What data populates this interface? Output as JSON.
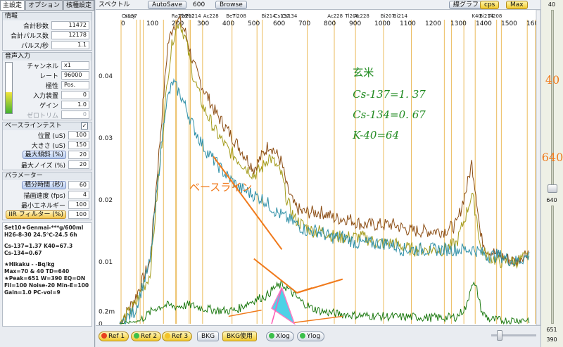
{
  "tabs": [
    "主設定",
    "オプション",
    "核種設定"
  ],
  "counts": {
    "header": "情報",
    "rows": [
      {
        "label": "合計秒数",
        "value": "11472"
      },
      {
        "label": "合計パルス数",
        "value": "12178"
      },
      {
        "label": "パルス/秒",
        "value": "1.1"
      }
    ]
  },
  "audio": {
    "header": "音声入力",
    "rows": [
      {
        "label": "チャンネル",
        "value": "x1"
      },
      {
        "label": "レート",
        "value": "96000"
      },
      {
        "label": "極性",
        "value": "Pos."
      },
      {
        "label": "入力装置",
        "value": "0"
      },
      {
        "label": "ゲイン",
        "value": "1.0"
      },
      {
        "label": "ゼロトリム",
        "value": "0"
      }
    ]
  },
  "baseline": {
    "header": "ベースラインテスト",
    "checked": "✓",
    "rows": [
      {
        "label": "位置 (uS)",
        "value": "100"
      },
      {
        "label": "大きさ (uS)",
        "value": "150"
      },
      {
        "label": "最大傾斜 (%)",
        "value": "20"
      },
      {
        "label": "最大ノイズ (%)",
        "value": "20"
      }
    ]
  },
  "params": {
    "header": "パラメーター",
    "rows": [
      {
        "label": "積分時間 (秒)",
        "value": "60"
      },
      {
        "label": "描画速度 (fps)",
        "value": "4"
      },
      {
        "label": "最小エネルギー",
        "value": "100"
      },
      {
        "label": "IIR フィルター (%)",
        "value": "100"
      }
    ]
  },
  "info": [
    "Set10★Genmai-***g/600ml",
    "H26-8-30  24.5℃-24.5  6h",
    "",
    "Cs-137=1.37  K40=67.3",
    "Cs-134=0.67",
    "",
    "★Hikaku    - -Bq/kg",
    "Max=70 & 40 TD=640",
    "★Peak=651 W=390 EQ=ON",
    "Fil=100  Noise-20  Min-E=100",
    "Gain=1.0 PC-vol=9"
  ],
  "toolbar": {
    "title": "スペクトル",
    "autosave": "AutoSave",
    "channel_value": "600",
    "browse": "Browse",
    "line_graph": "線グラフ",
    "cps": "cps",
    "max": "Max"
  },
  "right": {
    "top": "40",
    "big1": "40",
    "big2": "640",
    "mid": "640",
    "bot1": "651",
    "bot2": "390"
  },
  "bottom": {
    "ref1": "Ref 1",
    "ref2": "Ref 2",
    "ref3": "Ref 3",
    "bkg": "BKG",
    "bkg_use": "BKG使用",
    "xlog": "Xlog",
    "ylog": "Ylog"
  },
  "annotation": {
    "sample": "玄米",
    "lines": [
      "Cs-137=1. 37",
      "Cs-134=0. 67",
      "K-40=64"
    ],
    "baseline_label": "ベースライン"
  },
  "chart_data": {
    "type": "line",
    "x_ticks": [
      0,
      100,
      200,
      300,
      400,
      500,
      600,
      700,
      800,
      900,
      1000,
      1100,
      1200,
      1300,
      1400,
      1500,
      1600
    ],
    "y_ticks": [
      "0.04",
      "0.03",
      "0.02",
      "0.01",
      "0.2m",
      "0"
    ],
    "nuclide_labels": [
      "Cs137",
      "Xray",
      "Ra226",
      "Pb212",
      "Pb214",
      "Ac228",
      "Be7",
      "Tl208",
      "Bi214",
      "Cs137",
      "Cs134",
      "Ac228",
      "Tl208",
      "Ac228",
      "Bi207",
      "Bi214",
      "K40",
      "Bi214",
      "Tl208"
    ],
    "colors": {
      "brown": "#8b4c12",
      "olive": "#a29a18",
      "teal": "#2e8fa6",
      "green": "#1d7a12",
      "marker": "#e8b040",
      "accent": "#f07a1c"
    },
    "series": [
      {
        "color": "brown",
        "x": [
          0,
          60,
          120,
          190,
          210,
          235,
          260,
          290,
          330,
          380,
          430,
          480,
          530,
          560,
          590,
          610,
          640,
          660,
          690,
          720,
          760,
          800,
          850,
          900,
          960,
          1020,
          1080,
          1150,
          1220,
          1280,
          1330,
          1370,
          1390,
          1410,
          1425,
          1450,
          1500,
          1560,
          1620
        ],
        "y": [
          0.0,
          0.004,
          0.01,
          0.045,
          0.048,
          0.049,
          0.047,
          0.042,
          0.038,
          0.034,
          0.031,
          0.028,
          0.025,
          0.027,
          0.029,
          0.028,
          0.026,
          0.022,
          0.019,
          0.018,
          0.018,
          0.018,
          0.017,
          0.017,
          0.016,
          0.016,
          0.016,
          0.015,
          0.015,
          0.015,
          0.016,
          0.022,
          0.026,
          0.02,
          0.014,
          0.012,
          0.011,
          0.01,
          0.012
        ]
      },
      {
        "color": "olive",
        "x": [
          0,
          60,
          120,
          190,
          210,
          235,
          260,
          290,
          330,
          380,
          430,
          480,
          530,
          560,
          590,
          610,
          640,
          660,
          690,
          720,
          760,
          800,
          850,
          900,
          960,
          1020,
          1080,
          1150,
          1220,
          1280,
          1330,
          1370,
          1390,
          1410,
          1425,
          1450,
          1500,
          1560,
          1620
        ],
        "y": [
          0.0,
          0.003,
          0.008,
          0.04,
          0.046,
          0.049,
          0.046,
          0.04,
          0.035,
          0.031,
          0.028,
          0.026,
          0.024,
          0.025,
          0.027,
          0.026,
          0.024,
          0.02,
          0.017,
          0.016,
          0.015,
          0.015,
          0.014,
          0.014,
          0.014,
          0.013,
          0.013,
          0.012,
          0.012,
          0.012,
          0.013,
          0.018,
          0.021,
          0.017,
          0.012,
          0.011,
          0.01,
          0.01,
          0.011
        ]
      },
      {
        "color": "teal",
        "x": [
          0,
          60,
          120,
          180,
          210,
          240,
          270,
          300,
          340,
          380,
          420,
          470,
          520,
          570,
          620,
          660,
          700,
          740,
          780,
          830,
          880,
          940,
          1000,
          1060,
          1120,
          1180,
          1240,
          1300,
          1360,
          1400,
          1450,
          1500,
          1560,
          1620
        ],
        "y": [
          0.0,
          0.002,
          0.01,
          0.035,
          0.039,
          0.037,
          0.034,
          0.031,
          0.028,
          0.026,
          0.024,
          0.022,
          0.021,
          0.02,
          0.018,
          0.017,
          0.016,
          0.015,
          0.015,
          0.014,
          0.014,
          0.013,
          0.013,
          0.013,
          0.012,
          0.012,
          0.012,
          0.012,
          0.012,
          0.012,
          0.011,
          0.011,
          0.01,
          0.011
        ]
      },
      {
        "color": "green",
        "x": [
          0,
          80,
          140,
          180,
          220,
          280,
          330,
          380,
          420,
          460,
          500,
          540,
          580,
          610,
          640,
          660,
          690,
          720,
          760,
          800,
          860,
          920,
          980,
          1040,
          1100,
          1160,
          1220,
          1280,
          1330,
          1370,
          1390,
          1410,
          1430,
          1460,
          1520,
          1580,
          1620
        ],
        "y": [
          0.0,
          0.0005,
          0.0025,
          0.003,
          0.0028,
          0.003,
          0.0025,
          0.0022,
          0.0021,
          0.0022,
          0.0032,
          0.004,
          0.0045,
          0.0058,
          0.0063,
          0.0058,
          0.0046,
          0.0035,
          0.0025,
          0.002,
          0.0016,
          0.0014,
          0.0013,
          0.0012,
          0.0011,
          0.0011,
          0.001,
          0.001,
          0.0011,
          0.0028,
          0.0068,
          0.0055,
          0.0018,
          0.0007,
          0.0005,
          0.0006,
          0.0007
        ]
      }
    ],
    "xlim": [
      0,
      1650
    ],
    "ylim": [
      0,
      0.05
    ]
  }
}
